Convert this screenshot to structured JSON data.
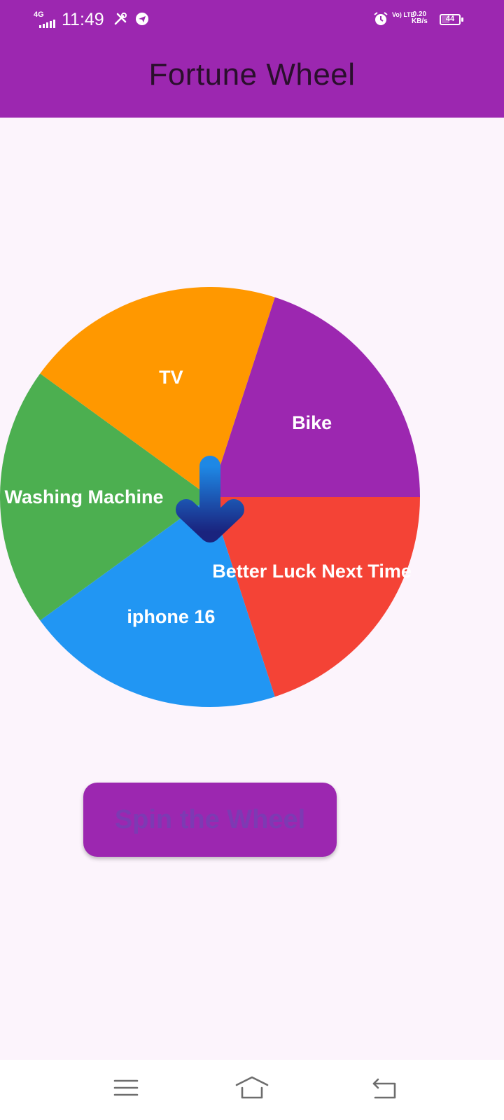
{
  "status_bar": {
    "network": "4G",
    "time": "11:49",
    "volte": "Vo) LTE",
    "speed_value": "0.20",
    "speed_unit": "KB/s",
    "battery": "44",
    "icons": [
      "tools-icon",
      "telegram-icon",
      "alarm-icon"
    ]
  },
  "app_bar": {
    "title": "Fortune Wheel"
  },
  "wheel": {
    "segments": [
      {
        "label": "Bike",
        "color": "#9c27b0"
      },
      {
        "label": "Better Luck Next Time",
        "color": "#f44336"
      },
      {
        "label": "iphone 16",
        "color": "#2196f3"
      },
      {
        "label": "Washing Machine",
        "color": "#4caf50"
      },
      {
        "label": "TV",
        "color": "#ff9800"
      }
    ],
    "pointer_icon": "down-arrow-icon",
    "pointer_color": "#1565c0"
  },
  "spin_button": {
    "label": "Spin the Wheel"
  },
  "nav_bar": {
    "icons": [
      "menu-icon",
      "home-icon",
      "back-icon"
    ]
  },
  "colors": {
    "primary": "#9c27b0",
    "background": "#fcf4fc"
  }
}
